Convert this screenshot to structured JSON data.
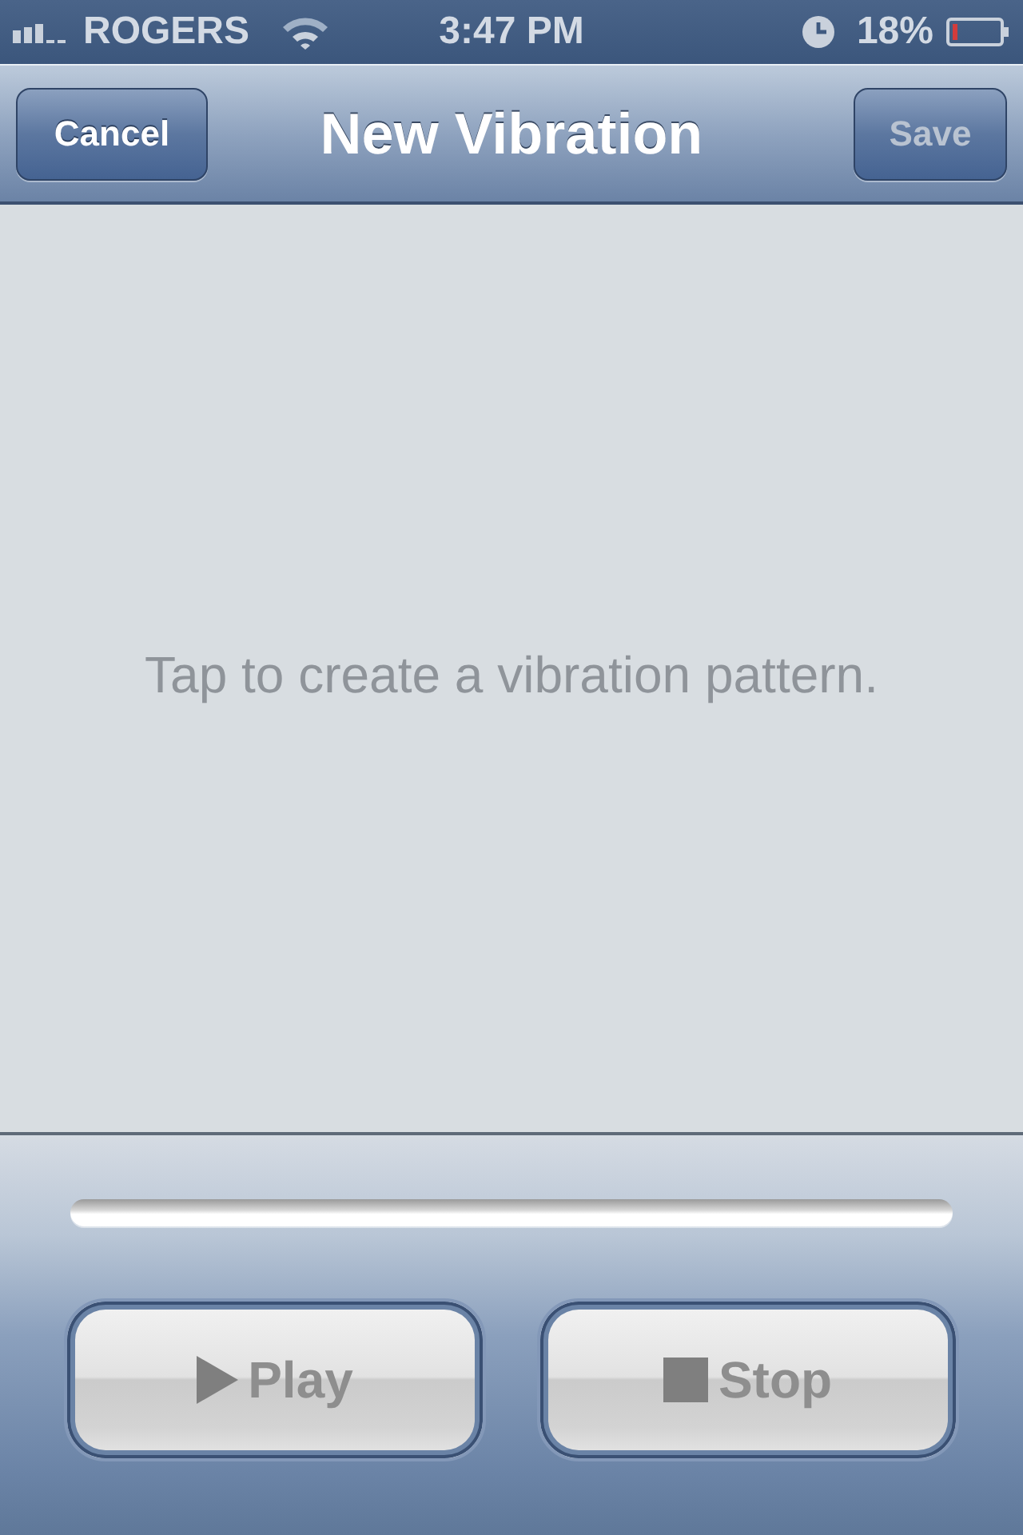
{
  "status_bar": {
    "carrier": "ROGERS",
    "time": "3:47 PM",
    "battery_percent": "18%"
  },
  "nav_bar": {
    "left_button": {
      "label": "Cancel",
      "disabled": false
    },
    "title": "New Vibration",
    "right_button": {
      "label": "Save",
      "disabled": true
    }
  },
  "canvas": {
    "hint": "Tap to create a vibration pattern."
  },
  "toolbar": {
    "buttons": [
      {
        "kind": "play",
        "label": "Play",
        "disabled": true
      },
      {
        "kind": "stop",
        "label": "Stop",
        "disabled": true
      }
    ]
  }
}
